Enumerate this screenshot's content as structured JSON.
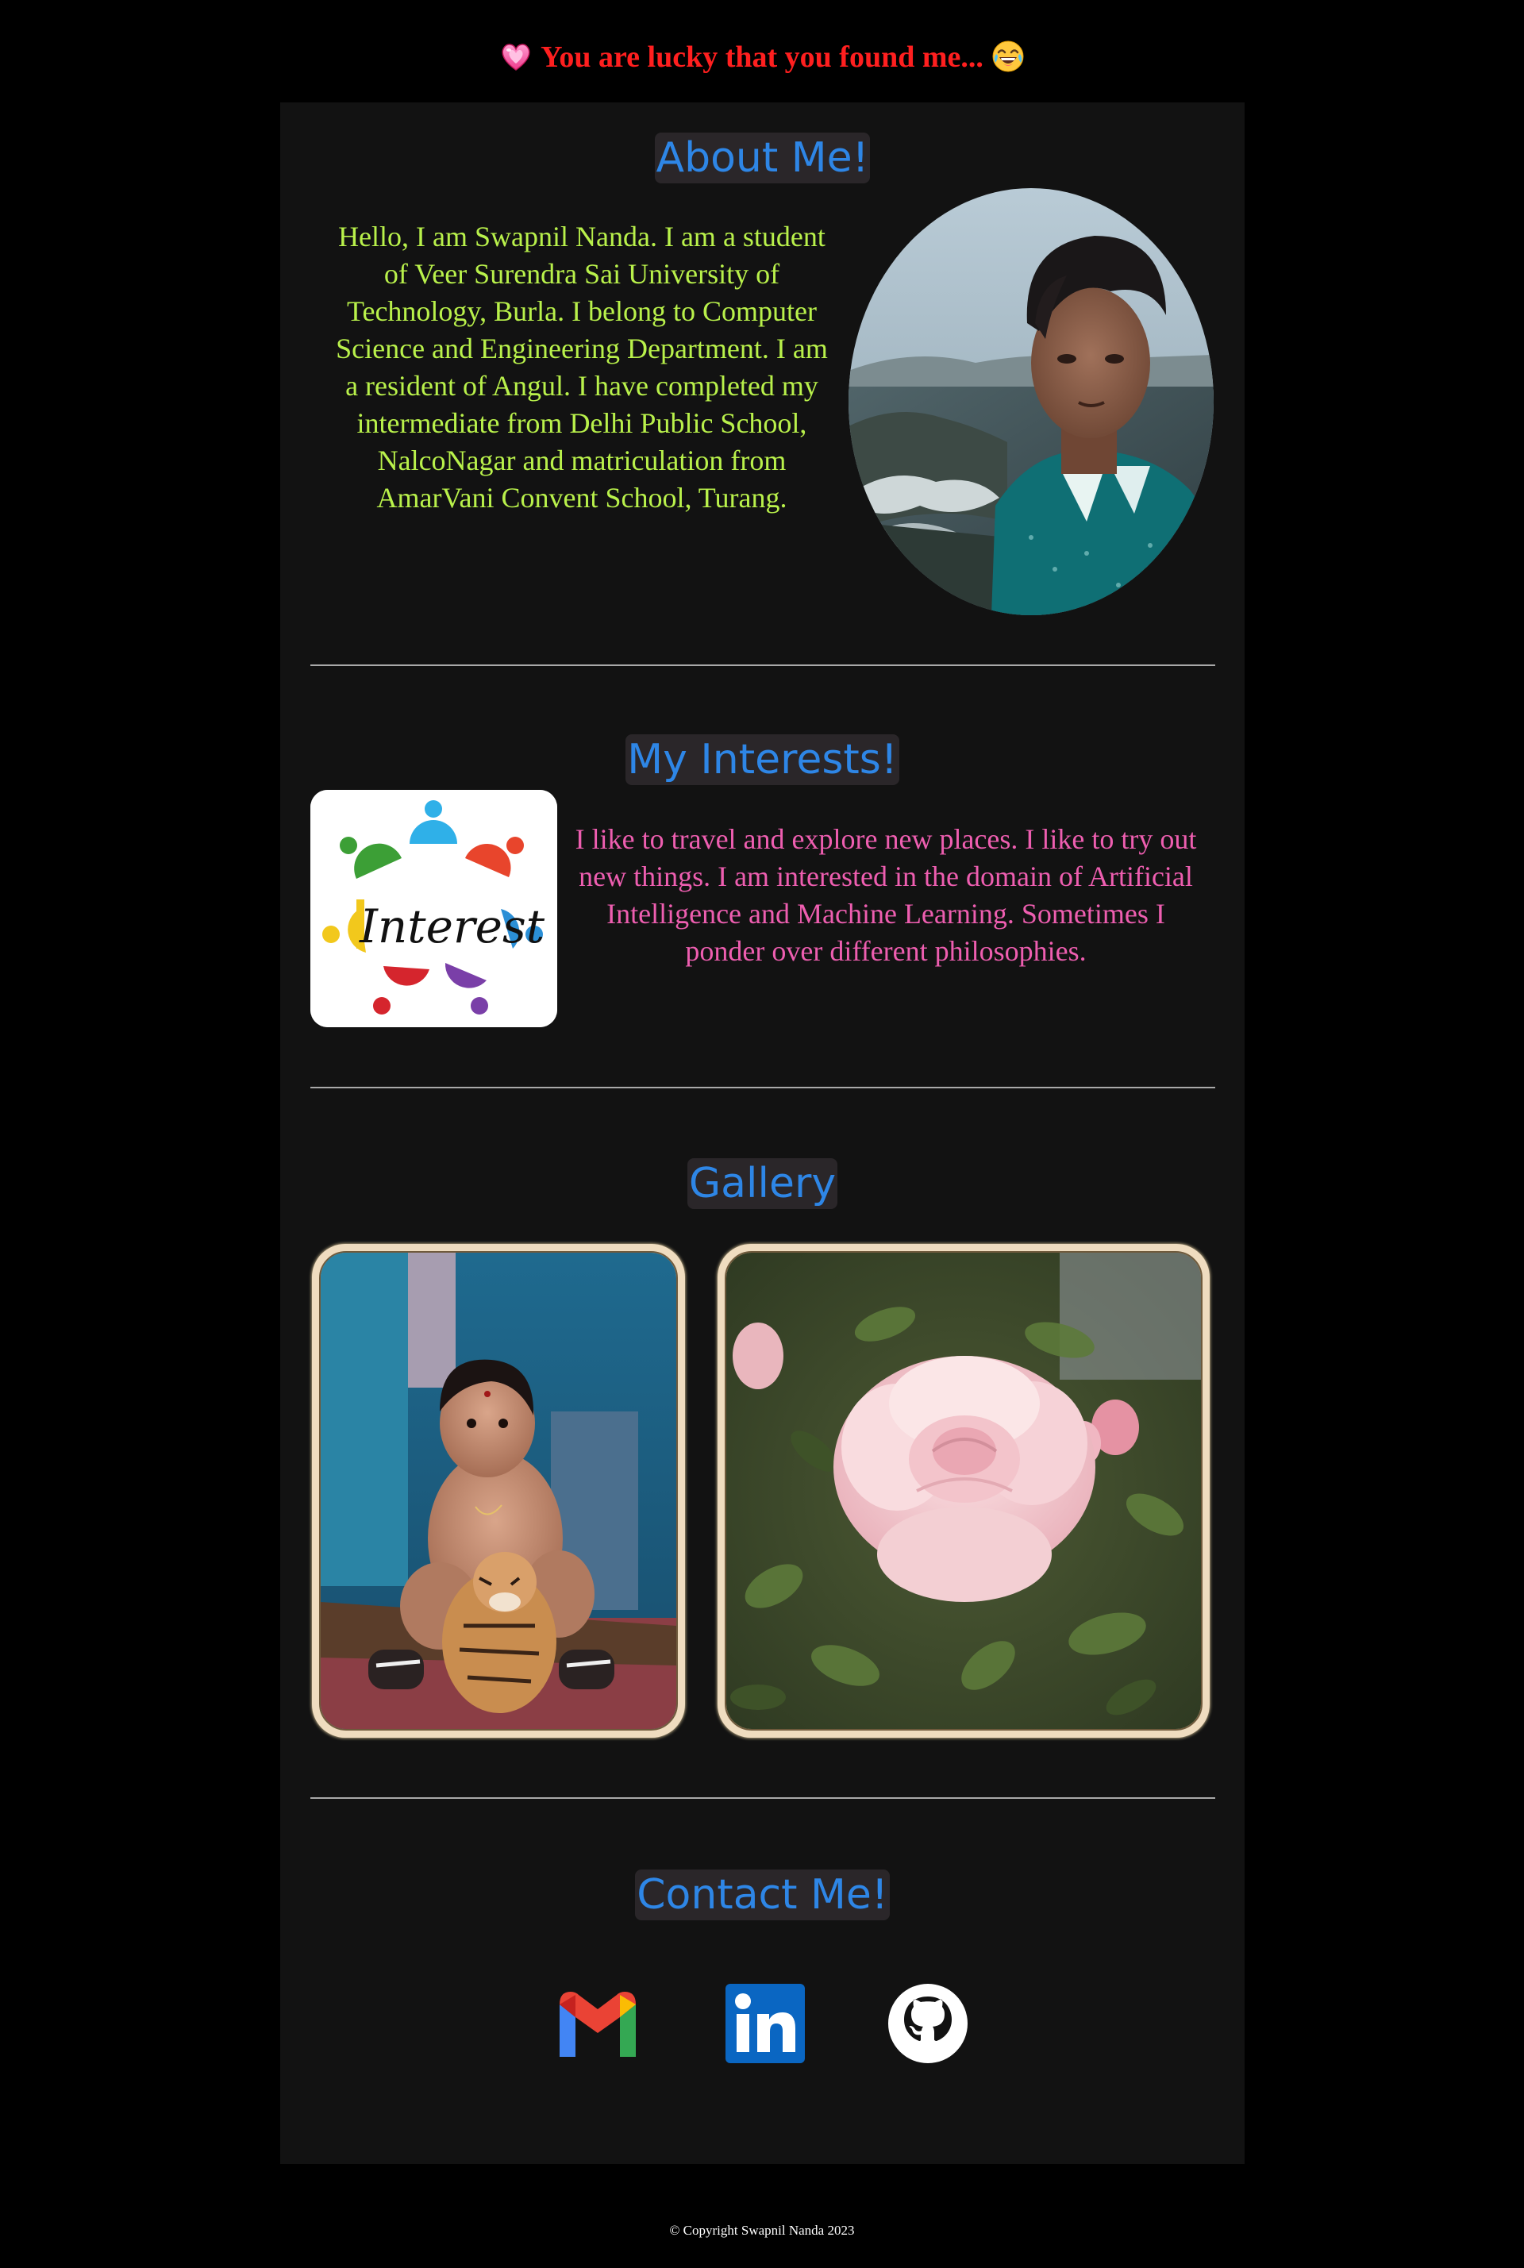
{
  "banner": {
    "text": "You are lucky that you found me...",
    "left_emoji": "heart-emoji",
    "right_emoji": "laughing-emoji"
  },
  "about": {
    "title": "About Me!",
    "text": "Hello, I am Swapnil Nanda. I am a student of Veer Surendra Sai University of Technology, Burla. I belong to Computer Science and Engineering Department. I am a resident of Angul. I have completed my intermediate from Delhi Public School, NalcoNagar and matriculation from AmarVani Convent School, Turang."
  },
  "interests": {
    "title": "My Interests!",
    "logo_word": "Interest",
    "text": "I like to travel and explore new places. I like to try out new things. I am interested in the domain of Artificial Intelligence and Machine Learning. Sometimes I ponder over different philosophies."
  },
  "gallery": {
    "title": "Gallery"
  },
  "contact": {
    "title": "Contact Me!",
    "icons": [
      "gmail-icon",
      "linkedin-icon",
      "github-icon"
    ]
  },
  "footer": {
    "text": "© Copyright Swapnil Nanda 2023"
  },
  "colors": {
    "background": "#000000",
    "card": "#121212",
    "title": "#2e86e6",
    "about_text": "#b9f14b",
    "interest_text": "#ee5eb0",
    "banner": "#ff1f1f"
  }
}
